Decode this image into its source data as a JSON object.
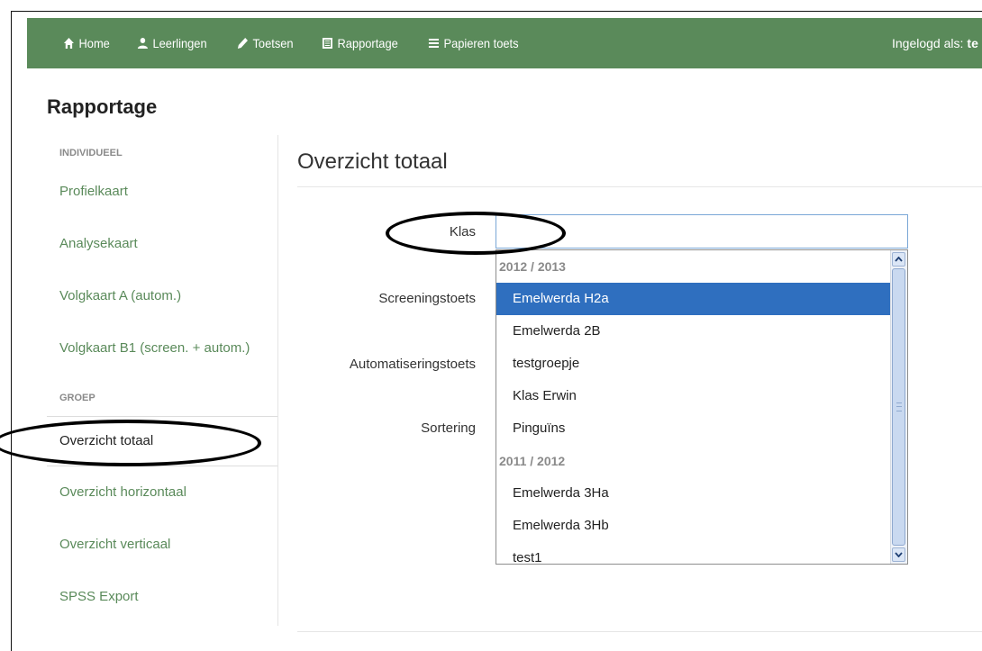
{
  "navbar": {
    "items": [
      {
        "label": "Home",
        "icon": "home-icon"
      },
      {
        "label": "Leerlingen",
        "icon": "user-icon"
      },
      {
        "label": "Toetsen",
        "icon": "pencil-icon"
      },
      {
        "label": "Rapportage",
        "icon": "list-alt-icon"
      },
      {
        "label": "Papieren toets",
        "icon": "menu-icon"
      }
    ],
    "login_prefix": "Ingelogd als:",
    "login_user": "te"
  },
  "page_title": "Rapportage",
  "sidebar": {
    "header_individual": "INDIVIDUEEL",
    "header_group": "GROEP",
    "items": [
      {
        "label": "Profielkaart"
      },
      {
        "label": "Analysekaart"
      },
      {
        "label": "Volgkaart A (autom.)"
      },
      {
        "label": "Volgkaart B1 (screen. + autom.)"
      },
      {
        "label": "Overzicht totaal"
      },
      {
        "label": "Overzicht horizontaal"
      },
      {
        "label": "Overzicht verticaal"
      },
      {
        "label": "SPSS Export"
      }
    ]
  },
  "main": {
    "title": "Overzicht totaal",
    "form": {
      "klas_label": "Klas",
      "screening_label": "Screeningstoets",
      "automatisering_label": "Automatiseringstoets",
      "sortering_label": "Sortering"
    }
  },
  "dropdown": {
    "group1": "2012 / 2013",
    "group1_options": [
      "Emelwerda H2a",
      "Emelwerda 2B",
      "testgroepje",
      "Klas Erwin",
      "Pinguïns"
    ],
    "group2": "2011 / 2012",
    "group2_options": [
      "Emelwerda 3Ha",
      "Emelwerda 3Hb",
      "test1"
    ],
    "selected": "Emelwerda H2a"
  },
  "colors": {
    "navbar": "#5a8a5a",
    "link": "#5a8a5a",
    "selected": "#2f6fbf"
  }
}
